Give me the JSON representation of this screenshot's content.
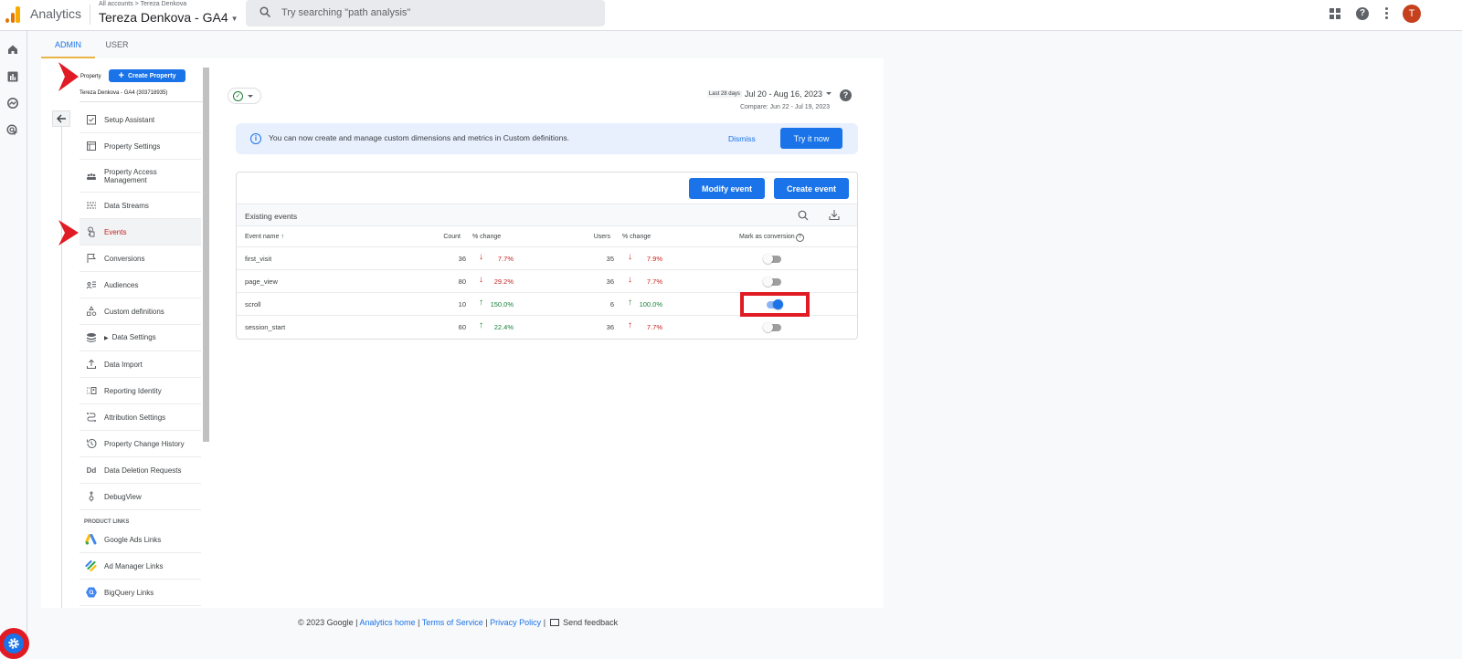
{
  "topbar": {
    "app_name": "Analytics",
    "breadcrumb": "All accounts > Tereza Denkova",
    "account_name": "Tereza Denkova - GA4",
    "search_placeholder": "Try searching \"path analysis\"",
    "avatar_letter": "T",
    "icons": [
      "apps-icon",
      "help-icon",
      "more-vert-icon"
    ]
  },
  "rail": {
    "icons": [
      "home-icon",
      "reports-icon",
      "explore-icon",
      "advertising-icon"
    ],
    "bottom_icon": "admin-gear-icon"
  },
  "tabs": [
    {
      "label": "ADMIN",
      "active": true
    },
    {
      "label": "USER",
      "active": false
    }
  ],
  "property": {
    "label": "Property",
    "create_button": "Create Property",
    "name": "Tereza Denkova - GA4 (303718935)"
  },
  "sidebar": {
    "items": [
      {
        "label": "Setup Assistant",
        "icon": "checklist-icon"
      },
      {
        "label": "Property Settings",
        "icon": "settings-panel-icon"
      },
      {
        "label": "Property Access Management",
        "icon": "people-icon"
      },
      {
        "label": "Data Streams",
        "icon": "streams-icon"
      },
      {
        "label": "Events",
        "icon": "touch-icon",
        "active": true
      },
      {
        "label": "Conversions",
        "icon": "flag-icon"
      },
      {
        "label": "Audiences",
        "icon": "audience-icon"
      },
      {
        "label": "Custom definitions",
        "icon": "shapes-icon"
      },
      {
        "label": "Data Settings",
        "icon": "database-icon",
        "expandable": true
      },
      {
        "label": "Data Import",
        "icon": "upload-icon"
      },
      {
        "label": "Reporting Identity",
        "icon": "identity-icon"
      },
      {
        "label": "Attribution Settings",
        "icon": "attribution-icon"
      },
      {
        "label": "Property Change History",
        "icon": "history-icon"
      },
      {
        "label": "Data Deletion Requests",
        "icon": "deletion-icon"
      },
      {
        "label": "DebugView",
        "icon": "debug-icon"
      }
    ],
    "product_links_title": "PRODUCT LINKS",
    "product_links": [
      {
        "label": "Google Ads Links",
        "icon": "google-ads-icon"
      },
      {
        "label": "Ad Manager Links",
        "icon": "ad-manager-icon"
      },
      {
        "label": "BigQuery Links",
        "icon": "bigquery-icon"
      }
    ]
  },
  "date": {
    "badge": "Last 28 days",
    "range": "Jul 20 - Aug 16, 2023",
    "compare": "Compare: Jun 22 - Jul 19, 2023"
  },
  "banner": {
    "message": "You can now create and manage custom dimensions and metrics in Custom definitions.",
    "dismiss": "Dismiss",
    "try_now": "Try it now"
  },
  "events": {
    "modify_button": "Modify event",
    "create_button": "Create event",
    "section_title": "Existing events",
    "columns": {
      "name": "Event name",
      "count": "Count",
      "count_change": "% change",
      "users": "Users",
      "users_change": "% change",
      "conversion": "Mark as conversion"
    },
    "rows": [
      {
        "name": "first_visit",
        "count": "36",
        "count_dir": "down",
        "count_change": "7.7%",
        "users": "35",
        "users_dir": "down",
        "users_change": "7.9%",
        "conversion": false
      },
      {
        "name": "page_view",
        "count": "80",
        "count_dir": "down",
        "count_change": "29.2%",
        "users": "36",
        "users_dir": "down",
        "users_change": "7.7%",
        "conversion": false
      },
      {
        "name": "scroll",
        "count": "10",
        "count_dir": "up",
        "count_change": "150.0%",
        "users": "6",
        "users_dir": "up",
        "users_change": "100.0%",
        "conversion": true
      },
      {
        "name": "session_start",
        "count": "60",
        "count_dir": "up",
        "count_change": "22.4%",
        "users": "36",
        "users_dir": "up-red",
        "users_change": "7.7%",
        "conversion": false
      }
    ]
  },
  "footer": {
    "copyright": "© 2023 Google |",
    "analytics_home": "Analytics home",
    "sep": "|",
    "terms": "Terms of Service",
    "privacy": "Privacy Policy",
    "send_feedback": "Send feedback"
  },
  "colors": {
    "accent": "#1a73e8",
    "active_nav": "#c5221f",
    "positive": "#188038",
    "negative": "#c5221f",
    "annotation_red": "#e01b24",
    "tab_underline": "#e8b447"
  }
}
